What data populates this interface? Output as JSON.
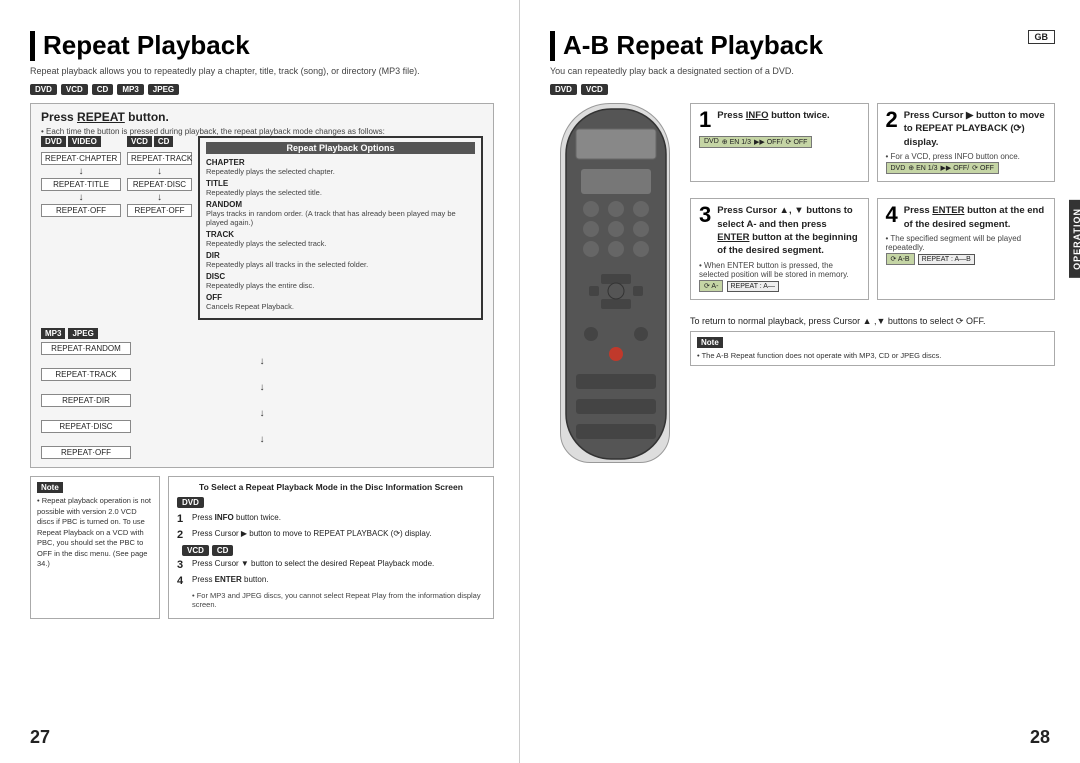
{
  "left": {
    "title": "Repeat Playback",
    "title_bar": true,
    "subtitle": "Repeat playback allows you to repeatedly play a chapter, title, track (song), or directory (MP3 file).",
    "badges": [
      "DVD",
      "VCD",
      "CD",
      "MP3",
      "JPEG"
    ],
    "press_repeat": {
      "main": "Press REPEAT button.",
      "repeat_word": "REPEAT",
      "sub": "• Each time the button is pressed during playback, the repeat playback mode changes as follows:"
    },
    "dvd_video_label": "DVD VIDEO",
    "dvd_items": [
      "REPEAT·CHAPTER",
      "↓",
      "REPEAT·TITLE",
      "↓",
      "REPEAT·OFF"
    ],
    "vcd_cd_label1": "VCD",
    "vcd_cd_label2": "CD",
    "vcd_items": [
      "REPEAT·TRACK",
      "↓",
      "REPEAT·DISC",
      "↓",
      "REPEAT·OFF"
    ],
    "mp3_jpeg_labels": [
      "MP3",
      "JPEG"
    ],
    "mp3_items": [
      "REPEAT·RANDOM",
      "↓",
      "REPEAT·TRACK",
      "↓",
      "REPEAT·DIR",
      "↓",
      "REPEAT·DISC",
      "↓",
      "REPEAT·OFF"
    ],
    "options_title": "Repeat Playback Options",
    "options": [
      {
        "name": "CHAPTER",
        "desc": "Repeatedly plays the selected chapter."
      },
      {
        "name": "TITLE",
        "desc": "Repeatedly plays the selected title."
      },
      {
        "name": "RANDOM",
        "desc": "Plays tracks in random order. (A track that has already been played may be played again.)"
      },
      {
        "name": "TRACK",
        "desc": "Repeatedly plays the selected track."
      },
      {
        "name": "DIR",
        "desc": "Repeatedly plays all tracks in the selected folder."
      },
      {
        "name": "DISC",
        "desc": "Repeatedly plays the entire disc."
      },
      {
        "name": "OFF",
        "desc": "Cancels Repeat Playback."
      }
    ],
    "note_title": "Note",
    "note_text": "• Repeat playback operation is not possible with version 2.0 VCD discs if PBC is turned on. To use Repeat Playback on a VCD with PBC, you should set the PBC to OFF in the disc menu. (See page 34.)",
    "select_title": "To Select a Repeat Playback Mode in the Disc Information Screen",
    "select_dvd": "DVD",
    "select_steps": [
      {
        "num": "1",
        "text": "Press INFO button twice."
      },
      {
        "num": "2",
        "text": "Press Cursor ▶ button to move to REPEAT PLAYBACK (⟳) display."
      },
      {
        "num": "3",
        "text": "Press Cursor ▼ button to select the desired Repeat Playback mode."
      },
      {
        "num": "4",
        "text": "Press ENTER button."
      }
    ],
    "select_note": "• For MP3 and JPEG discs, you cannot select Repeat Play from the information display screen.",
    "vcd_cd_badges": [
      "VCD",
      "CD"
    ],
    "page_num": "27"
  },
  "right": {
    "title": "A-B Repeat Playback",
    "title_bar": true,
    "gb_badge": "GB",
    "subtitle": "You can repeatedly play back a designated section of a DVD.",
    "badges": [
      "DVD",
      "VCD"
    ],
    "steps": [
      {
        "num": "1",
        "text": "Press INFO button twice.",
        "info_bold": "INFO",
        "note": ""
      },
      {
        "num": "2",
        "text": "Press Cursor ▶ button to move to REPEAT PLAYBACK (⟳) display.",
        "cursor_bold": "Cursor ▶",
        "note": "• For a VCD, press INFO button once."
      },
      {
        "num": "3",
        "text": "Press Cursor ▲, ▼ buttons to select  A- and then press ENTER button at the beginning of the desired segment.",
        "enter_bold": "ENTER",
        "note": "• When ENTER button is pressed, the selected position will be stored in memory."
      },
      {
        "num": "4",
        "text": "Press ENTER button at the end of the desired segment.",
        "enter_bold": "ENTER",
        "note": "• The specified segment will be played repeatedly."
      }
    ],
    "return_text": "To return to normal playback, press Cursor ▲ ,▼ buttons to select ⟳ OFF.",
    "note_title": "Note",
    "note_text": "• The A-B Repeat function does not operate with MP3, CD or JPEG discs.",
    "repeat_ab_label": "REPEAT : A—B",
    "repeat_a_label": "REPEAT : A—",
    "operation_label": "OPERATION",
    "page_num": "28"
  }
}
